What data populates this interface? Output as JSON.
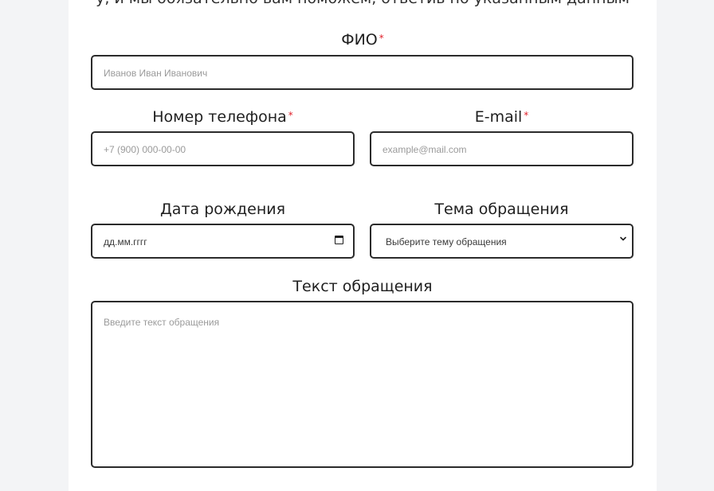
{
  "header": {
    "partial_text": "у, и мы обязательно вам поможем, ответив по указанным данным"
  },
  "form": {
    "fio": {
      "label": "ФИО",
      "required_mark": "*",
      "placeholder": "Иванов Иван Иванович"
    },
    "phone": {
      "label": "Номер телефона",
      "required_mark": "*",
      "placeholder": "+7 (900) 000-00-00"
    },
    "email": {
      "label": "E-mail",
      "required_mark": "*",
      "placeholder": "example@mail.com"
    },
    "birthdate": {
      "label": "Дата рождения",
      "value": "дд.мм.гггг",
      "icon": "calendar-icon"
    },
    "topic": {
      "label": "Тема обращения",
      "selected": "Выберите тему обращения",
      "icon": "chevron-down-icon"
    },
    "message": {
      "label": "Текст обращения",
      "placeholder": "Введите текст обращения"
    }
  },
  "colors": {
    "page_bg": "#f3f4f6",
    "card_bg": "#ffffff",
    "border": "#2b2b2b",
    "required": "#e0202a",
    "placeholder": "#9a9a9a"
  }
}
